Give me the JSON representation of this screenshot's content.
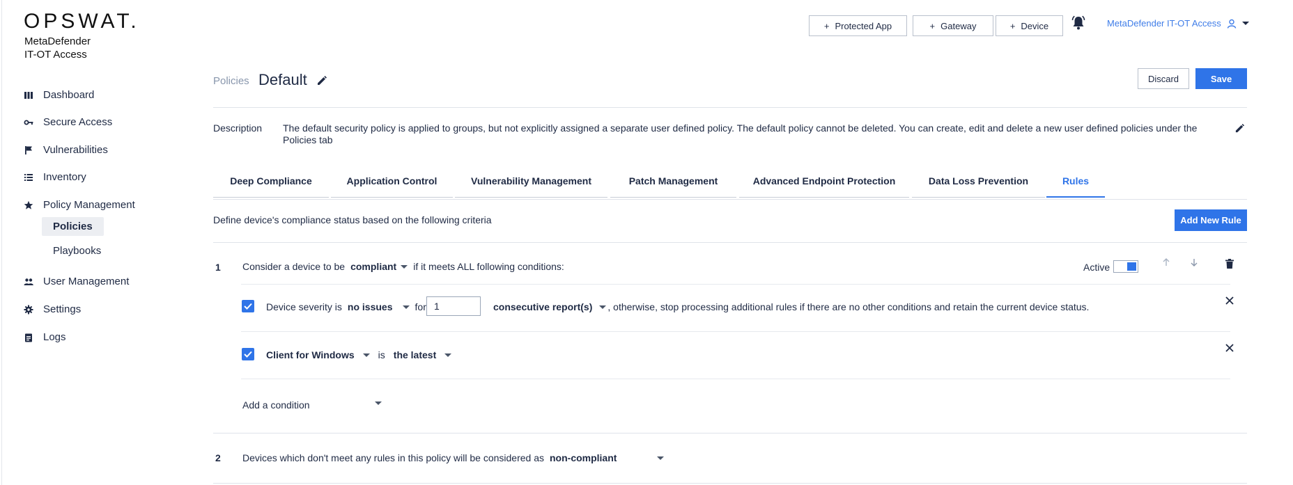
{
  "brand": {
    "logo": "OPSWAT.",
    "product_line1": "MetaDefender",
    "product_line2": "IT-OT Access"
  },
  "sidebar": {
    "items": [
      {
        "label": "Dashboard",
        "icon": "dashboard-icon"
      },
      {
        "label": "Secure Access",
        "icon": "key-icon"
      },
      {
        "label": "Vulnerabilities",
        "icon": "flag-icon"
      },
      {
        "label": "Inventory",
        "icon": "list-icon"
      },
      {
        "label": "Policy Management",
        "icon": "star-icon"
      },
      {
        "label": "User Management",
        "icon": "users-icon"
      },
      {
        "label": "Settings",
        "icon": "gear-icon"
      },
      {
        "label": "Logs",
        "icon": "clipboard-icon"
      }
    ],
    "subitems": [
      {
        "label": "Policies",
        "active": true
      },
      {
        "label": "Playbooks",
        "active": false
      }
    ]
  },
  "header": {
    "buttons": [
      {
        "label": "Protected App"
      },
      {
        "label": "Gateway"
      },
      {
        "label": "Device"
      }
    ],
    "user_label": "MetaDefender IT-OT Access"
  },
  "page": {
    "breadcrumb": "Policies",
    "title": "Default",
    "discard_label": "Discard",
    "save_label": "Save",
    "description_label": "Description",
    "description_text": "The default security policy is applied to groups, but not explicitly assigned a separate user defined policy. The default policy cannot be deleted. You can create, edit and delete a new user defined policies under the Policies tab"
  },
  "tabs": [
    {
      "label": "Deep Compliance"
    },
    {
      "label": "Application Control"
    },
    {
      "label": "Vulnerability Management"
    },
    {
      "label": "Patch Management"
    },
    {
      "label": "Advanced Endpoint Protection"
    },
    {
      "label": "Data Loss Prevention"
    },
    {
      "label": "Rules",
      "active": true
    }
  ],
  "rules": {
    "criteria_text": "Define device's compliance status based on the following criteria",
    "add_rule_label": "Add New Rule",
    "rule1": {
      "number": "1",
      "prefix": "Consider a device to be",
      "status": "compliant",
      "suffix": "if it meets ALL following conditions:",
      "active_label": "Active",
      "active": true,
      "cond1": {
        "checked": true,
        "label": "Device severity is",
        "severity": "no issues",
        "for_text": "for",
        "count": "1",
        "unit": "consecutive report(s)",
        "tail": ", otherwise, stop processing additional rules if there are no other conditions and retain the current device status."
      },
      "cond2": {
        "checked": true,
        "subject": "Client for Windows",
        "is_text": "is",
        "value": "the latest"
      },
      "add_condition_label": "Add a condition"
    },
    "rule2": {
      "number": "2",
      "text": "Devices which don't meet any rules in this policy will be considered as",
      "status": "non-compliant"
    }
  }
}
